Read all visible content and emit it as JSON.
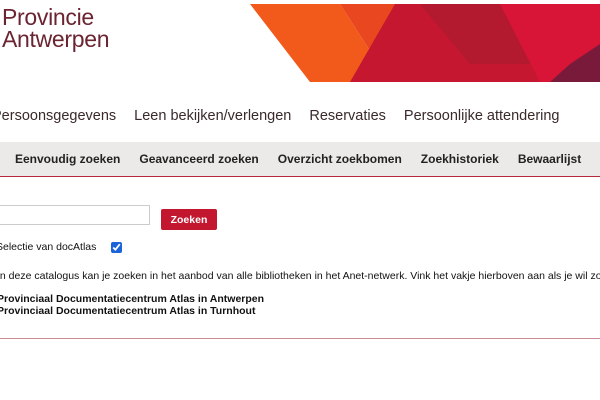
{
  "header": {
    "logo_line1": "Provincie",
    "logo_line2": "Antwerpen",
    "colors": {
      "logo": "#6b2431",
      "banner_orange": "#f2661e",
      "banner_red": "#c8102e",
      "banner_dark_red": "#a5152f",
      "banner_crimson": "#d6153a"
    }
  },
  "main_nav": {
    "items": [
      {
        "label": "Persoonsgegevens"
      },
      {
        "label": "Leen bekijken/verlengen"
      },
      {
        "label": "Reservaties"
      },
      {
        "label": "Persoonlijke attendering"
      }
    ]
  },
  "sub_nav": {
    "items": [
      {
        "label": "Eenvoudig zoeken"
      },
      {
        "label": "Geavanceerd zoeken"
      },
      {
        "label": "Overzicht zoekbomen"
      },
      {
        "label": "Zoekhistoriek"
      },
      {
        "label": "Bewaarlijst"
      }
    ]
  },
  "search": {
    "value": "",
    "placeholder": "",
    "button_label": "Zoeken",
    "selection_label": "Selectie van docAtlas",
    "selection_checked": true
  },
  "info": {
    "text": "In deze catalogus kan je zoeken in het aanbod van alle bibliotheken in het Anet-netwerk. Vink het vakje hierboven aan als je wil zoeken in het aanbod van"
  },
  "libraries": [
    "Provinciaal Documentatiecentrum Atlas in Antwerpen",
    "Provinciaal Documentatiecentrum Atlas in Turnhout"
  ],
  "theme": {
    "accent": "#c3162f",
    "subnav_bg": "#eceae8"
  }
}
